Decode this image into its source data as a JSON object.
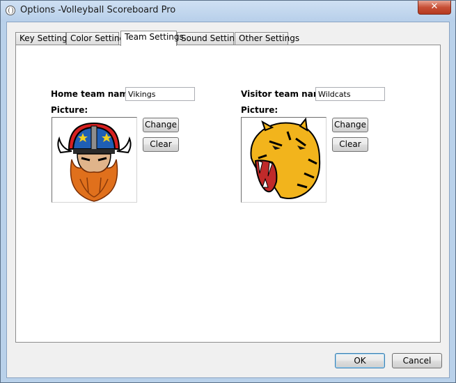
{
  "window": {
    "title": "Options -Volleyball Scoreboard Pro",
    "close_glyph": "✕"
  },
  "tabs": [
    {
      "label": "Key Settings"
    },
    {
      "label": "Color Settings"
    },
    {
      "label": "Team Settings",
      "active": true
    },
    {
      "label": "Sound Settings"
    },
    {
      "label": "Other Settings"
    }
  ],
  "home": {
    "name_label": "Home team name:",
    "name_value": "Vikings",
    "picture_label": "Picture:",
    "change_label": "Change",
    "clear_label": "Clear"
  },
  "visitor": {
    "name_label": "Visitor team name:",
    "name_value": "Wildcats",
    "picture_label": "Picture:",
    "change_label": "Change",
    "clear_label": "Clear"
  },
  "footer": {
    "ok_label": "OK",
    "cancel_label": "Cancel"
  }
}
